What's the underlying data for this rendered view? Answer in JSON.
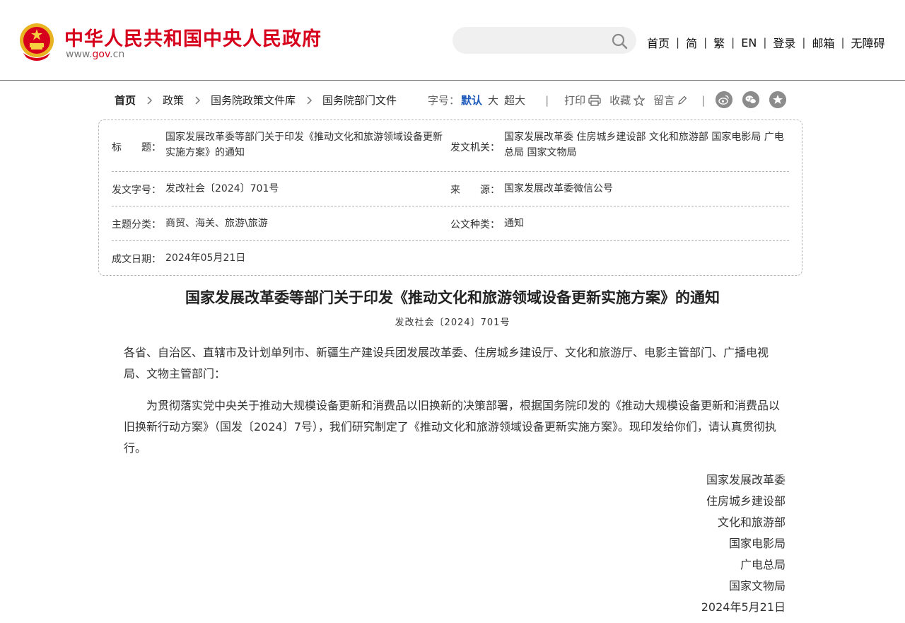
{
  "header": {
    "site_name": "中华人民共和国中央人民政府",
    "domain_prefix": "www.",
    "domain_main": "gov",
    "domain_suffix": ".cn",
    "search_placeholder": "",
    "nav": [
      "首页",
      "简",
      "繁",
      "EN",
      "登录",
      "邮箱",
      "无障碍"
    ],
    "colors": {
      "brand_red": "#d6001c",
      "accent_blue": "#1f5bb8"
    }
  },
  "breadcrumb": [
    "首页",
    "政策",
    "国务院政策文件库",
    "国务院部门文件"
  ],
  "toolbar": {
    "font_label": "字号：",
    "font_default": "默认",
    "font_large": "大",
    "font_xlarge": "超大",
    "print": "打印",
    "favorite": "收藏",
    "comment": "留言",
    "share_icons": [
      "weibo-icon",
      "wechat-icon",
      "favorite-star-icon"
    ]
  },
  "info": {
    "title_label": "标　　题：",
    "title_value": "国家发展改革委等部门关于印发《推动文化和旅游领域设备更新实施方案》的通知",
    "issuer_label": "发文机关：",
    "issuer_value": "国家发展改革委  住房城乡建设部  文化和旅游部  国家电影局  广电总局  国家文物局",
    "number_label": "发文字号：",
    "number_value": "发改社会〔2024〕701号",
    "source_label": "来　　源：",
    "source_value": "国家发展改革委微信公号",
    "topic_label": "主题分类：",
    "topic_value": "商贸、海关、旅游\\旅游",
    "type_label": "公文种类：",
    "type_value": "通知",
    "date_label": "成文日期：",
    "date_value": "2024年05月21日"
  },
  "article": {
    "title": "国家发展改革委等部门关于印发《推动文化和旅游领域设备更新实施方案》的通知",
    "doc_number": "发改社会〔2024〕701号",
    "salutation": "各省、自治区、直辖市及计划单列市、新疆生产建设兵团发展改革委、住房城乡建设厅、文化和旅游厅、电影主管部门、广播电视局、文物主管部门：",
    "body": "　　为贯彻落实党中央关于推动大规模设备更新和消费品以旧换新的决策部署，根据国务院印发的《推动大规模设备更新和消费品以旧换新行动方案》（国发〔2024〕7号），我们研究制定了《推动文化和旅游领域设备更新实施方案》。现印发给你们，请认真贯彻执行。",
    "signers": [
      "国家发展改革委",
      "住房城乡建设部",
      "文化和旅游部",
      "国家电影局",
      "广电总局",
      "国家文物局"
    ],
    "date": "2024年5月21日"
  }
}
